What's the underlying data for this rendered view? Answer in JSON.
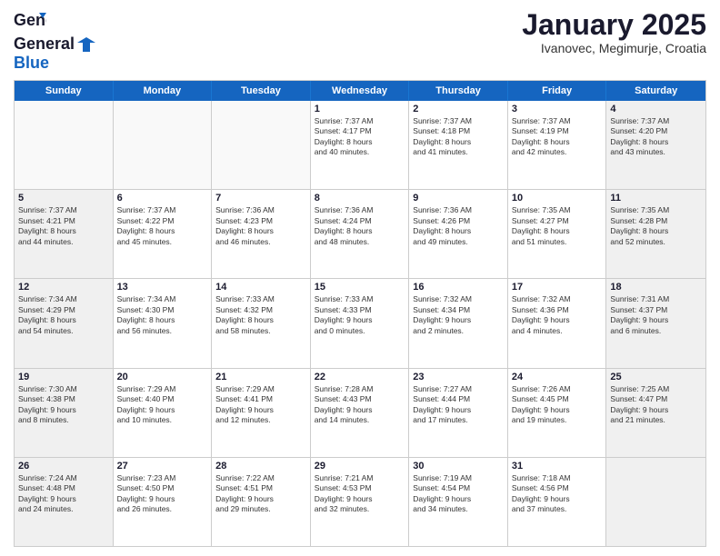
{
  "header": {
    "logo": {
      "general": "General",
      "blue": "Blue"
    },
    "title": "January 2025",
    "location": "Ivanovec, Megimurje, Croatia"
  },
  "weekdays": [
    "Sunday",
    "Monday",
    "Tuesday",
    "Wednesday",
    "Thursday",
    "Friday",
    "Saturday"
  ],
  "rows": [
    [
      {
        "day": "",
        "info": "",
        "empty": true
      },
      {
        "day": "",
        "info": "",
        "empty": true
      },
      {
        "day": "",
        "info": "",
        "empty": true
      },
      {
        "day": "1",
        "info": "Sunrise: 7:37 AM\nSunset: 4:17 PM\nDaylight: 8 hours\nand 40 minutes.",
        "empty": false
      },
      {
        "day": "2",
        "info": "Sunrise: 7:37 AM\nSunset: 4:18 PM\nDaylight: 8 hours\nand 41 minutes.",
        "empty": false
      },
      {
        "day": "3",
        "info": "Sunrise: 7:37 AM\nSunset: 4:19 PM\nDaylight: 8 hours\nand 42 minutes.",
        "empty": false
      },
      {
        "day": "4",
        "info": "Sunrise: 7:37 AM\nSunset: 4:20 PM\nDaylight: 8 hours\nand 43 minutes.",
        "empty": false,
        "shaded": true
      }
    ],
    [
      {
        "day": "5",
        "info": "Sunrise: 7:37 AM\nSunset: 4:21 PM\nDaylight: 8 hours\nand 44 minutes.",
        "empty": false,
        "shaded": true
      },
      {
        "day": "6",
        "info": "Sunrise: 7:37 AM\nSunset: 4:22 PM\nDaylight: 8 hours\nand 45 minutes.",
        "empty": false
      },
      {
        "day": "7",
        "info": "Sunrise: 7:36 AM\nSunset: 4:23 PM\nDaylight: 8 hours\nand 46 minutes.",
        "empty": false
      },
      {
        "day": "8",
        "info": "Sunrise: 7:36 AM\nSunset: 4:24 PM\nDaylight: 8 hours\nand 48 minutes.",
        "empty": false
      },
      {
        "day": "9",
        "info": "Sunrise: 7:36 AM\nSunset: 4:26 PM\nDaylight: 8 hours\nand 49 minutes.",
        "empty": false
      },
      {
        "day": "10",
        "info": "Sunrise: 7:35 AM\nSunset: 4:27 PM\nDaylight: 8 hours\nand 51 minutes.",
        "empty": false
      },
      {
        "day": "11",
        "info": "Sunrise: 7:35 AM\nSunset: 4:28 PM\nDaylight: 8 hours\nand 52 minutes.",
        "empty": false,
        "shaded": true
      }
    ],
    [
      {
        "day": "12",
        "info": "Sunrise: 7:34 AM\nSunset: 4:29 PM\nDaylight: 8 hours\nand 54 minutes.",
        "empty": false,
        "shaded": true
      },
      {
        "day": "13",
        "info": "Sunrise: 7:34 AM\nSunset: 4:30 PM\nDaylight: 8 hours\nand 56 minutes.",
        "empty": false
      },
      {
        "day": "14",
        "info": "Sunrise: 7:33 AM\nSunset: 4:32 PM\nDaylight: 8 hours\nand 58 minutes.",
        "empty": false
      },
      {
        "day": "15",
        "info": "Sunrise: 7:33 AM\nSunset: 4:33 PM\nDaylight: 9 hours\nand 0 minutes.",
        "empty": false
      },
      {
        "day": "16",
        "info": "Sunrise: 7:32 AM\nSunset: 4:34 PM\nDaylight: 9 hours\nand 2 minutes.",
        "empty": false
      },
      {
        "day": "17",
        "info": "Sunrise: 7:32 AM\nSunset: 4:36 PM\nDaylight: 9 hours\nand 4 minutes.",
        "empty": false
      },
      {
        "day": "18",
        "info": "Sunrise: 7:31 AM\nSunset: 4:37 PM\nDaylight: 9 hours\nand 6 minutes.",
        "empty": false,
        "shaded": true
      }
    ],
    [
      {
        "day": "19",
        "info": "Sunrise: 7:30 AM\nSunset: 4:38 PM\nDaylight: 9 hours\nand 8 minutes.",
        "empty": false,
        "shaded": true
      },
      {
        "day": "20",
        "info": "Sunrise: 7:29 AM\nSunset: 4:40 PM\nDaylight: 9 hours\nand 10 minutes.",
        "empty": false
      },
      {
        "day": "21",
        "info": "Sunrise: 7:29 AM\nSunset: 4:41 PM\nDaylight: 9 hours\nand 12 minutes.",
        "empty": false
      },
      {
        "day": "22",
        "info": "Sunrise: 7:28 AM\nSunset: 4:43 PM\nDaylight: 9 hours\nand 14 minutes.",
        "empty": false
      },
      {
        "day": "23",
        "info": "Sunrise: 7:27 AM\nSunset: 4:44 PM\nDaylight: 9 hours\nand 17 minutes.",
        "empty": false
      },
      {
        "day": "24",
        "info": "Sunrise: 7:26 AM\nSunset: 4:45 PM\nDaylight: 9 hours\nand 19 minutes.",
        "empty": false
      },
      {
        "day": "25",
        "info": "Sunrise: 7:25 AM\nSunset: 4:47 PM\nDaylight: 9 hours\nand 21 minutes.",
        "empty": false,
        "shaded": true
      }
    ],
    [
      {
        "day": "26",
        "info": "Sunrise: 7:24 AM\nSunset: 4:48 PM\nDaylight: 9 hours\nand 24 minutes.",
        "empty": false,
        "shaded": true
      },
      {
        "day": "27",
        "info": "Sunrise: 7:23 AM\nSunset: 4:50 PM\nDaylight: 9 hours\nand 26 minutes.",
        "empty": false
      },
      {
        "day": "28",
        "info": "Sunrise: 7:22 AM\nSunset: 4:51 PM\nDaylight: 9 hours\nand 29 minutes.",
        "empty": false
      },
      {
        "day": "29",
        "info": "Sunrise: 7:21 AM\nSunset: 4:53 PM\nDaylight: 9 hours\nand 32 minutes.",
        "empty": false
      },
      {
        "day": "30",
        "info": "Sunrise: 7:19 AM\nSunset: 4:54 PM\nDaylight: 9 hours\nand 34 minutes.",
        "empty": false
      },
      {
        "day": "31",
        "info": "Sunrise: 7:18 AM\nSunset: 4:56 PM\nDaylight: 9 hours\nand 37 minutes.",
        "empty": false
      },
      {
        "day": "",
        "info": "",
        "empty": true,
        "shaded": true
      }
    ]
  ]
}
